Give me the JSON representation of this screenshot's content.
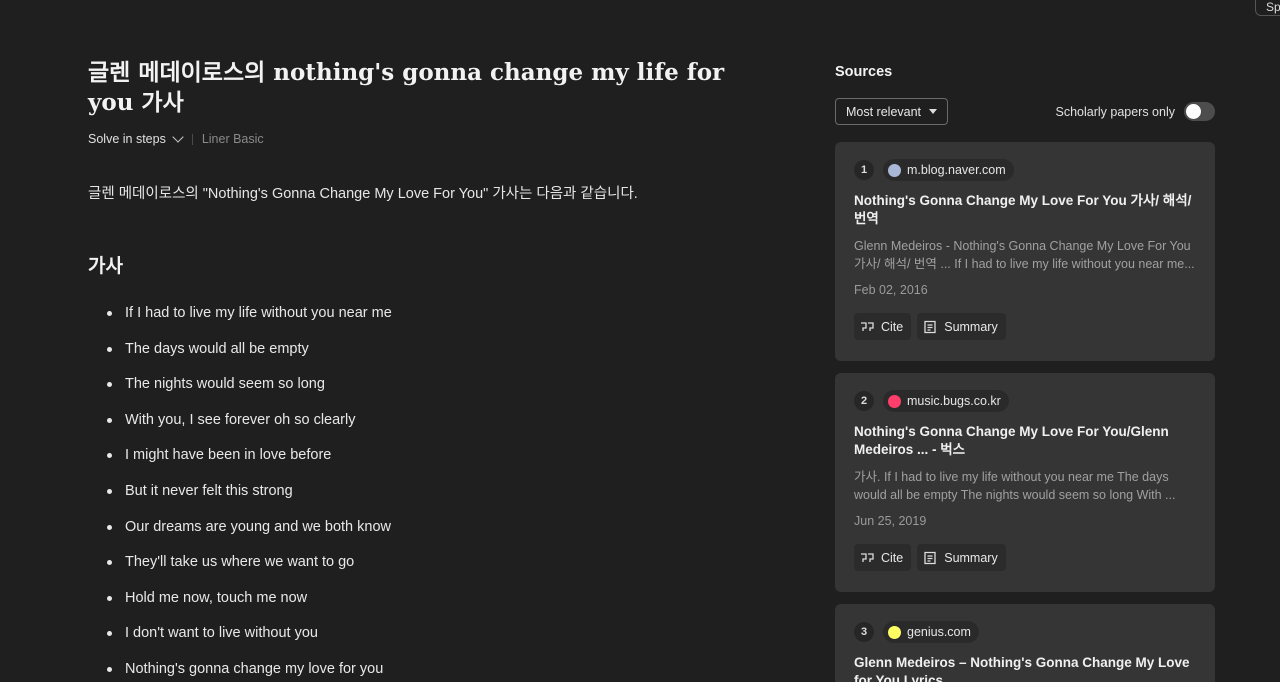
{
  "top_button": {
    "label": "Sp"
  },
  "main": {
    "title": "글렌 메데이로스의 nothing's gonna change my life for you 가사",
    "mode_label": "Solve in steps",
    "tier_label": "Liner Basic",
    "intro": "글렌 메데이로스의 \"Nothing's Gonna Change My Love For You\" 가사는 다음과 같습니다.",
    "section_heading": "가사",
    "lyrics": [
      "If I had to live my life without you near me",
      "The days would all be empty",
      "The nights would seem so long",
      "With you, I see forever oh so clearly",
      "I might have been in love before",
      "But it never felt this strong",
      "Our dreams are young and we both know",
      "They'll take us where we want to go",
      "Hold me now, touch me now",
      "I don't want to live without you",
      "Nothing's gonna change my love for you"
    ]
  },
  "sources": {
    "heading": "Sources",
    "sort_label": "Most relevant",
    "scholarly_label": "Scholarly papers only",
    "scholarly_on": false,
    "cite_label": "Cite",
    "summary_label": "Summary",
    "items": [
      {
        "num": "1",
        "domain": "m.blog.naver.com",
        "favicon_color": "#a9b7d6",
        "title": "Nothing's Gonna Change My Love For You 가사/ 해석/ 번역",
        "snippet": "Glenn Medeiros - Nothing's Gonna Change My Love For You 가사/ 해석/ 번역 ... If I had to live my life without you near me...",
        "date": "Feb 02, 2016"
      },
      {
        "num": "2",
        "domain": "music.bugs.co.kr",
        "favicon_color": "#ff3e6c",
        "title": "Nothing's Gonna Change My Love For You/Glenn Medeiros ... - 벅스",
        "snippet": "가사. If I had to live my life without you near me The days would all be empty The nights would seem so long With ...",
        "date": "Jun 25, 2019"
      },
      {
        "num": "3",
        "domain": "genius.com",
        "favicon_color": "#ffff64",
        "title": "Glenn Medeiros – Nothing's Gonna Change My Love for You Lyrics",
        "snippet": "",
        "date": ""
      }
    ]
  }
}
